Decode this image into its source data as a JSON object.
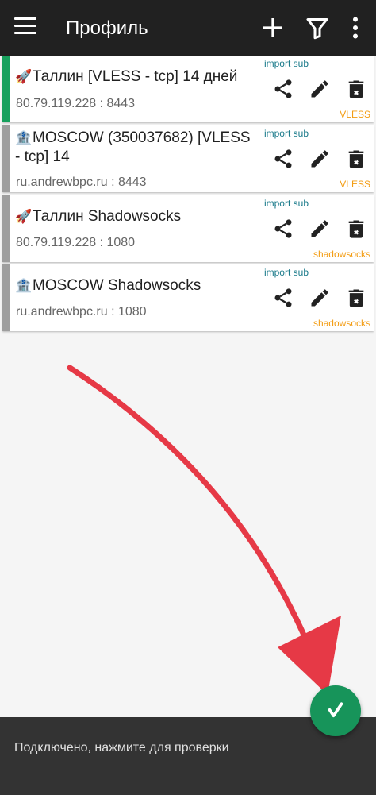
{
  "appbar": {
    "title": "Профиль",
    "background": "#212121"
  },
  "icons": [
    "menu-icon",
    "plus-icon",
    "filter-icon",
    "more-vert-icon",
    "share-icon",
    "pencil-icon",
    "delete-icon",
    "check-icon"
  ],
  "profiles": [
    {
      "emoji": "🚀",
      "name": "Таллин [VLESS - tcp] 14 дней",
      "address": "80.79.119.228 : 8443",
      "sub": "import sub",
      "type": "VLESS",
      "active": true,
      "indicator_color": "#17a05d"
    },
    {
      "emoji": "🏦",
      "name": "MOSCOW (350037682) [VLESS - tcp] 14",
      "address": "ru.andrewbpc.ru : 8443",
      "sub": "import sub",
      "type": "VLESS",
      "active": false,
      "indicator_color": "#9e9e9e"
    },
    {
      "emoji": "🚀",
      "name": "Таллин Shadowsocks",
      "address": "80.79.119.228 : 1080",
      "sub": "import sub",
      "type": "shadowsocks",
      "active": false,
      "indicator_color": "#9e9e9e"
    },
    {
      "emoji": "🏦",
      "name": "MOSCOW Shadowsocks",
      "address": "ru.andrewbpc.ru : 1080",
      "sub": "import sub",
      "type": "shadowsocks",
      "active": false,
      "indicator_color": "#9e9e9e"
    }
  ],
  "snackbar": {
    "message": "Подключено, нажмите для проверки"
  },
  "colors": {
    "fab": "#17945a",
    "annotation_arrow": "#e63946",
    "type_label": "#f39c12",
    "sub_label": "#1a7a8a"
  }
}
